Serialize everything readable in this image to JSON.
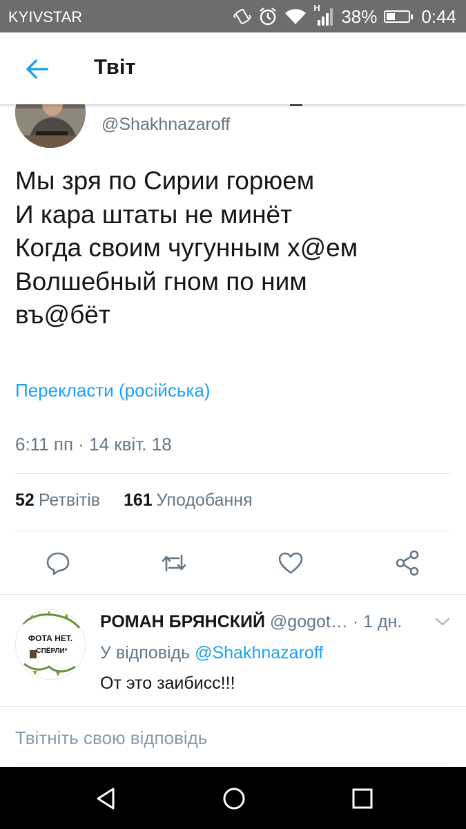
{
  "status_bar": {
    "carrier": "KYIVSTAR",
    "signal_label": "H",
    "battery": "38%",
    "battery_level": 0.38,
    "time": "0:44",
    "icons": [
      "vibrate-icon",
      "alarm-icon",
      "wifi-icon",
      "cell-signal-icon",
      "battery-icon"
    ]
  },
  "app_bar": {
    "title": "Твіт",
    "back_icon": "arrow-left-icon"
  },
  "tweet": {
    "handle": "@Shakhnazaroff",
    "text": "Мы зря по Сирии горюем\nИ кара штаты не минёт\nКогда своим чугунным х@ем\nВолшебный гном по ним\nвъ@бёт",
    "translate_label": "Перекласти (російська)",
    "timestamp": "6:11 пп · 14 квіт. 18",
    "retweets_count": "52",
    "retweets_label": "Ретвітів",
    "likes_count": "161",
    "likes_label": "Уподобання",
    "actions": [
      "reply-icon",
      "retweet-icon",
      "like-icon",
      "share-icon"
    ]
  },
  "reply": {
    "name": "РОМАН БРЯНСКИЙ",
    "handle": "@gogot…",
    "time": "· 1 дн.",
    "reply_to_label": "У відповідь",
    "reply_to_user": "@Shakhnazaroff",
    "text": "От это заибисс!!!",
    "avatar_line1": "ФОТА НЕТ.",
    "avatar_line2": "СПЁРЛИ*"
  },
  "compose": {
    "placeholder": "Твітніть свою відповідь"
  },
  "nav_bar": {
    "icons": [
      "back-triangle-icon",
      "home-circle-icon",
      "recents-square-icon"
    ]
  },
  "colors": {
    "accent": "#1da1f2",
    "secondary_text": "#657786",
    "status_bar": "#6d6d6d"
  }
}
